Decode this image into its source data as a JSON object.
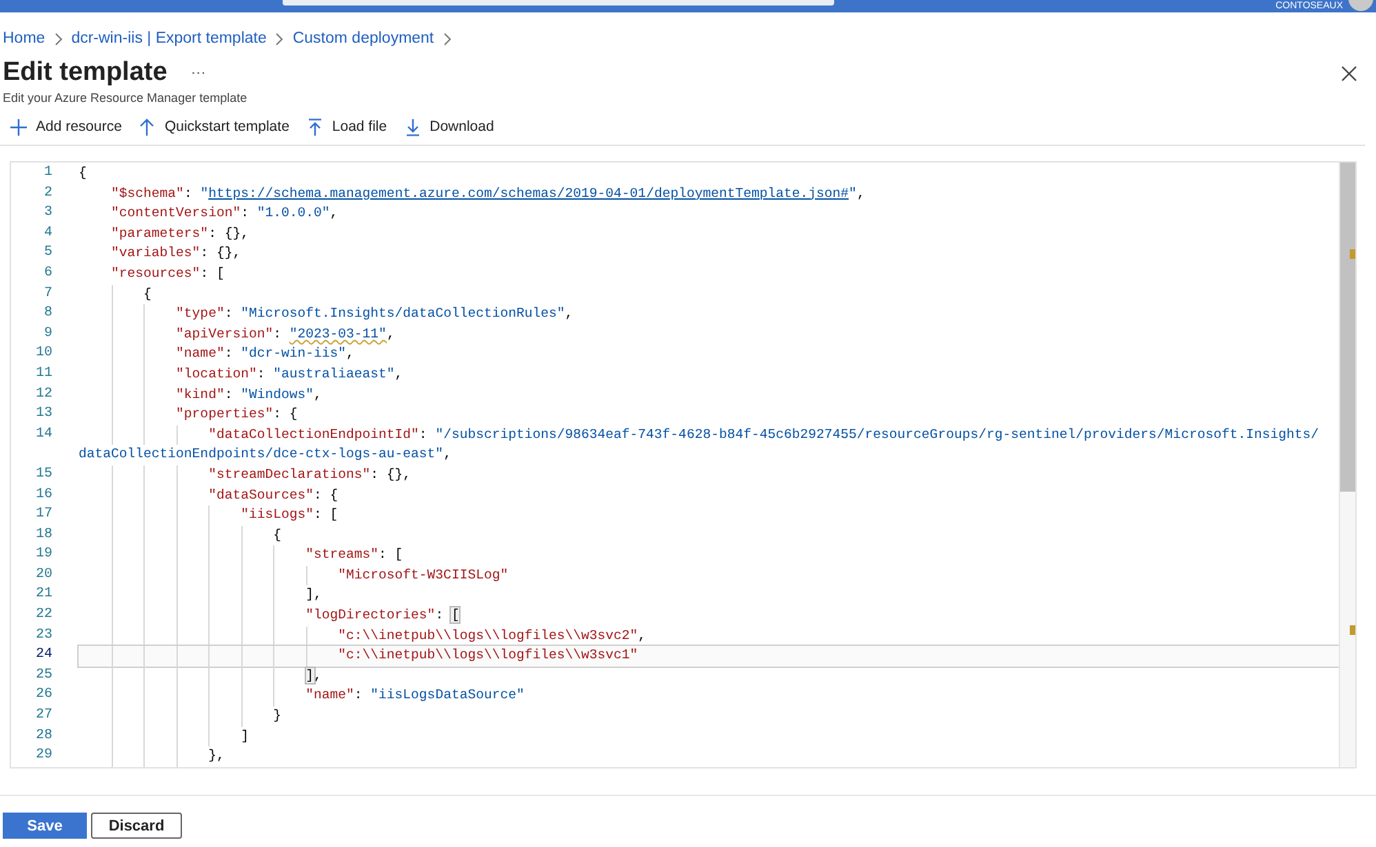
{
  "top_bar": {
    "account": "CONTOSEAUX"
  },
  "breadcrumb": [
    "Home",
    "dcr-win-iis | Export template",
    "Custom deployment"
  ],
  "header": {
    "title": "Edit template",
    "more": "···",
    "subtitle": "Edit your Azure Resource Manager template"
  },
  "toolbar": [
    {
      "kind": "add",
      "label": "Add resource"
    },
    {
      "kind": "quickstart",
      "label": "Quickstart template"
    },
    {
      "kind": "load",
      "label": "Load file"
    },
    {
      "kind": "download",
      "label": "Download"
    }
  ],
  "editor": {
    "lines": [
      {
        "number": "1",
        "current": false,
        "tokens": [
          {
            "kind": "punct",
            "text": "{"
          }
        ]
      },
      {
        "number": "2",
        "current": false,
        "tokens": [
          {
            "kind": "key",
            "text": "    \"$schema\""
          },
          {
            "kind": "punct",
            "text": ": "
          },
          {
            "kind": "string",
            "text": "\""
          },
          {
            "kind": "link",
            "text": "https://schema.management.azure.com/schemas/2019-04-01/deploymentTemplate.json#"
          },
          {
            "kind": "string",
            "text": "\""
          },
          {
            "kind": "punct",
            "text": ","
          }
        ]
      },
      {
        "number": "3",
        "current": false,
        "tokens": [
          {
            "kind": "key",
            "text": "    \"contentVersion\""
          },
          {
            "kind": "punct",
            "text": ": "
          },
          {
            "kind": "string",
            "text": "\"1.0.0.0\""
          },
          {
            "kind": "punct",
            "text": ","
          }
        ]
      },
      {
        "number": "4",
        "current": false,
        "tokens": [
          {
            "kind": "key",
            "text": "    \"parameters\""
          },
          {
            "kind": "punct",
            "text": ": {},"
          }
        ]
      },
      {
        "number": "5",
        "current": false,
        "tokens": [
          {
            "kind": "key",
            "text": "    \"variables\""
          },
          {
            "kind": "punct",
            "text": ": {},"
          }
        ]
      },
      {
        "number": "6",
        "current": false,
        "tokens": [
          {
            "kind": "key",
            "text": "    \"resources\""
          },
          {
            "kind": "punct",
            "text": ": ["
          }
        ]
      },
      {
        "number": "7",
        "current": false,
        "tokens": [
          {
            "kind": "punct",
            "text": "        {"
          }
        ]
      },
      {
        "number": "8",
        "current": false,
        "tokens": [
          {
            "kind": "key",
            "text": "            \"type\""
          },
          {
            "kind": "punct",
            "text": ": "
          },
          {
            "kind": "string",
            "text": "\"Microsoft.Insights/dataCollectionRules\""
          },
          {
            "kind": "punct",
            "text": ","
          }
        ]
      },
      {
        "number": "9",
        "current": false,
        "tokens": [
          {
            "kind": "key",
            "text": "            \"apiVersion\""
          },
          {
            "kind": "punct",
            "text": ": "
          },
          {
            "kind": "warning",
            "text": "\"2023-03-11\""
          },
          {
            "kind": "punct",
            "text": ","
          }
        ]
      },
      {
        "number": "10",
        "current": false,
        "tokens": [
          {
            "kind": "key",
            "text": "            \"name\""
          },
          {
            "kind": "punct",
            "text": ": "
          },
          {
            "kind": "string",
            "text": "\"dcr-win-iis\""
          },
          {
            "kind": "punct",
            "text": ","
          }
        ]
      },
      {
        "number": "11",
        "current": false,
        "tokens": [
          {
            "kind": "key",
            "text": "            \"location\""
          },
          {
            "kind": "punct",
            "text": ": "
          },
          {
            "kind": "string",
            "text": "\"australiaeast\""
          },
          {
            "kind": "punct",
            "text": ","
          }
        ]
      },
      {
        "number": "12",
        "current": false,
        "tokens": [
          {
            "kind": "key",
            "text": "            \"kind\""
          },
          {
            "kind": "punct",
            "text": ": "
          },
          {
            "kind": "string",
            "text": "\"Windows\""
          },
          {
            "kind": "punct",
            "text": ","
          }
        ]
      },
      {
        "number": "13",
        "current": false,
        "tokens": [
          {
            "kind": "key",
            "text": "            \"properties\""
          },
          {
            "kind": "punct",
            "text": ": {"
          }
        ]
      },
      {
        "number": "14",
        "current": false,
        "tokens": [
          {
            "kind": "key",
            "text": "                \"dataCollectionEndpointId\""
          },
          {
            "kind": "punct",
            "text": ": "
          },
          {
            "kind": "string",
            "text": "\"/subscriptions/98634eaf-743f-4628-b84f-45c6b2927455/resourceGroups/rg-sentinel/providers/Microsoft.Insights/"
          }
        ]
      },
      {
        "current": false,
        "tokens": [
          {
            "kind": "string",
            "text": "dataCollectionEndpoints/dce-ctx-logs-au-east\""
          },
          {
            "kind": "punct",
            "text": ","
          }
        ]
      },
      {
        "number": "15",
        "current": false,
        "tokens": [
          {
            "kind": "key",
            "text": "                \"streamDeclarations\""
          },
          {
            "kind": "punct",
            "text": ": {},"
          }
        ]
      },
      {
        "number": "16",
        "current": false,
        "tokens": [
          {
            "kind": "key",
            "text": "                \"dataSources\""
          },
          {
            "kind": "punct",
            "text": ": {"
          }
        ]
      },
      {
        "number": "17",
        "current": false,
        "tokens": [
          {
            "kind": "key",
            "text": "                    \"iisLogs\""
          },
          {
            "kind": "punct",
            "text": ": ["
          }
        ]
      },
      {
        "number": "18",
        "current": false,
        "tokens": [
          {
            "kind": "punct",
            "text": "                        {"
          }
        ]
      },
      {
        "number": "19",
        "current": false,
        "tokens": [
          {
            "kind": "key",
            "text": "                            \"streams\""
          },
          {
            "kind": "punct",
            "text": ": ["
          }
        ]
      },
      {
        "number": "20",
        "current": false,
        "tokens": [
          {
            "kind": "key",
            "text": "                                \"Microsoft-W3CIISLog\""
          }
        ]
      },
      {
        "number": "21",
        "current": false,
        "tokens": [
          {
            "kind": "punct",
            "text": "                            ],"
          }
        ]
      },
      {
        "number": "22",
        "current": false,
        "tokens": [
          {
            "kind": "key",
            "text": "                            \"logDirectories\""
          },
          {
            "kind": "punct",
            "text": ": "
          },
          {
            "kind": "match",
            "text": "["
          }
        ]
      },
      {
        "number": "23",
        "current": false,
        "tokens": [
          {
            "kind": "key",
            "text": "                                \"c:\\\\inetpub\\\\logs\\\\logfiles\\\\w3svc2\""
          },
          {
            "kind": "punct",
            "text": ","
          }
        ]
      },
      {
        "number": "24",
        "current": true,
        "tokens": [
          {
            "kind": "key",
            "text": "                                \"c:\\\\inetpub\\\\logs\\\\logfiles\\\\w3svc1\""
          }
        ]
      },
      {
        "number": "25",
        "current": false,
        "tokens": [
          {
            "kind": "match",
            "text": "                            ]"
          },
          {
            "kind": "punct",
            "text": ","
          }
        ]
      },
      {
        "number": "26",
        "current": false,
        "tokens": [
          {
            "kind": "key",
            "text": "                            \"name\""
          },
          {
            "kind": "punct",
            "text": ": "
          },
          {
            "kind": "string",
            "text": "\"iisLogsDataSource\""
          }
        ]
      },
      {
        "number": "27",
        "current": false,
        "tokens": [
          {
            "kind": "punct",
            "text": "                        }"
          }
        ]
      },
      {
        "number": "28",
        "current": false,
        "tokens": [
          {
            "kind": "punct",
            "text": "                    ]"
          }
        ]
      },
      {
        "number": "29",
        "current": false,
        "tokens": [
          {
            "kind": "punct",
            "text": "                },"
          }
        ]
      }
    ]
  },
  "footer": {
    "buttons": [
      {
        "kind": "primary",
        "label": "Save"
      },
      {
        "kind": "secondary",
        "label": "Discard"
      }
    ]
  }
}
